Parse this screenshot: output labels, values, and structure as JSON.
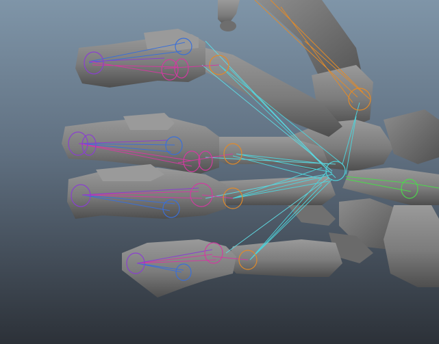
{
  "viewport": {
    "bg_top": "#7f95a8",
    "bg_bottom": "#2c3138"
  },
  "scene": {
    "subject": "hand-skeleton-rig",
    "bone_color": "#8e8e8e",
    "bone_shadow": "#4a4a4a",
    "joint_colors": {
      "finger": "#3a6fd8",
      "distal": "#d23aa0",
      "metacarpal": "#e08a2a",
      "wrist": "#4fd0d8",
      "forearm": "#4cd84c",
      "thumb": "#e08a2a"
    }
  }
}
